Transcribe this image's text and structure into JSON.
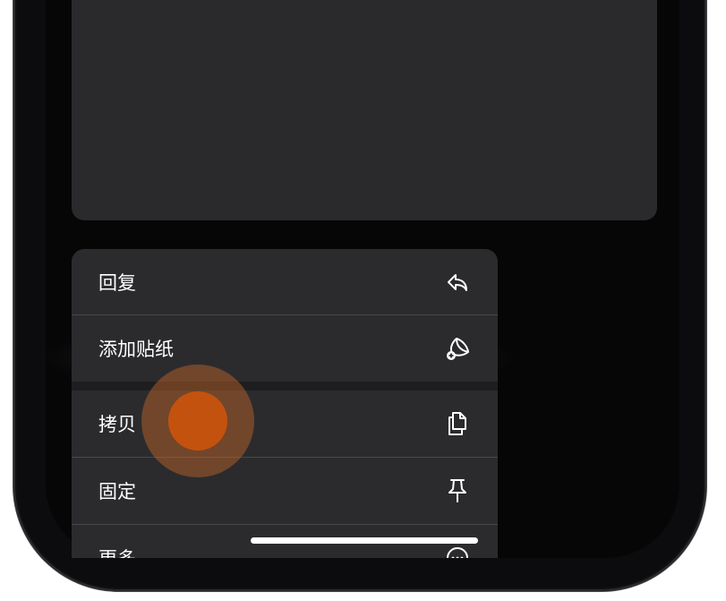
{
  "context_menu": {
    "items": [
      {
        "label": "回复",
        "icon": "reply-icon"
      },
      {
        "label": "添加贴纸",
        "icon": "add-sticker-icon"
      },
      {
        "label": "拷贝",
        "icon": "copy-icon"
      },
      {
        "label": "固定",
        "icon": "pin-icon"
      },
      {
        "label": "更多",
        "icon": "more-icon"
      }
    ]
  },
  "touch_indicator": {
    "color": "#c4520f"
  },
  "colors": {
    "menu_bg": "#2b2b2e",
    "preview_bg": "#2a2a2c",
    "text": "#ffffff"
  }
}
